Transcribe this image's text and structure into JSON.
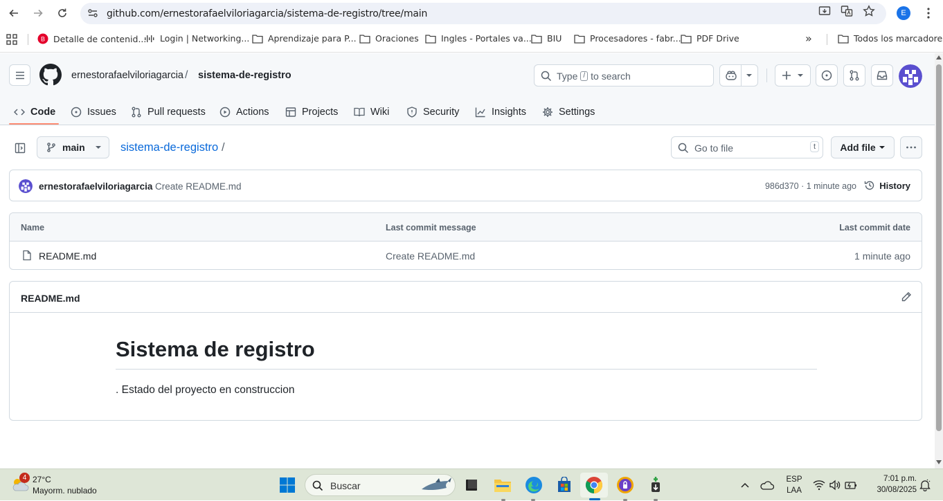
{
  "browser": {
    "url": "github.com/ernestorafaelviloriagarcia/sistema-de-registro/tree/main",
    "profile_initial": "E",
    "bookmarks": [
      "Detalle de contenid...",
      "Login | Networking...",
      "Aprendizaje para P...",
      "Oraciones",
      "Ingles - Portales va...",
      "BIU",
      "Procesadores - fabr...",
      "PDF Drive"
    ],
    "all_bookmarks_label": "Todos los marcadores",
    "more_bookmarks": "»"
  },
  "github": {
    "owner": "ernestorafaelviloriagarcia",
    "separator": "/",
    "repo": "sistema-de-registro",
    "search_placeholder_pre": "Type",
    "search_key": "/",
    "search_placeholder_post": "to search",
    "tabs": [
      "Code",
      "Issues",
      "Pull requests",
      "Actions",
      "Projects",
      "Wiki",
      "Security",
      "Insights",
      "Settings"
    ],
    "branch": "main",
    "path_repo": "sistema-de-registro",
    "path_slash": "/",
    "goto_placeholder": "Go to file",
    "goto_key": "t",
    "add_file_label": "Add file",
    "commit": {
      "author": "ernestorafaelviloriagarcia",
      "message": "Create README.md",
      "meta": "986d370 · 1 minute ago",
      "history_label": "History"
    },
    "table": {
      "col_name": "Name",
      "col_message": "Last commit message",
      "col_date": "Last commit date",
      "rows": [
        {
          "name": "README.md",
          "message": "Create README.md",
          "date": "1 minute ago"
        }
      ]
    },
    "readme": {
      "title": "README.md",
      "heading": "Sistema de registro",
      "paragraph": ". Estado del proyecto en construccion"
    }
  },
  "taskbar": {
    "weather_badge": "4",
    "temperature": "27°C",
    "weather": "Mayorm. nublado",
    "search_placeholder": "Buscar",
    "lang_top": "ESP",
    "lang_bottom": "LAA",
    "time": "7:01 p.m.",
    "date": "30/08/2025"
  },
  "colors": {
    "accent_blue": "#0969da",
    "tab_underline": "#fd8c73",
    "taskbar_bg": "#dee6d7"
  }
}
